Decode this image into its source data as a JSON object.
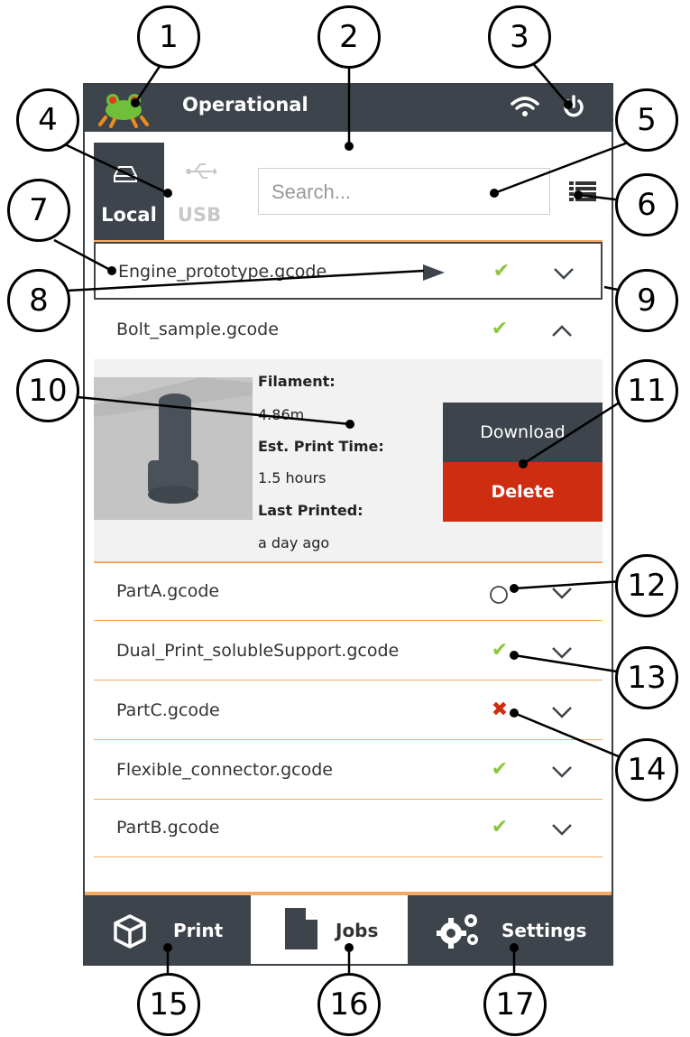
{
  "header": {
    "status_title": "Operational"
  },
  "source_tabs": [
    {
      "label": "Local"
    },
    {
      "label": "USB"
    }
  ],
  "search": {
    "placeholder": "Search..."
  },
  "files": [
    {
      "name": "Engine_prototype.gcode",
      "status": "check",
      "expanded": false,
      "selected": true
    },
    {
      "name": "Bolt_sample.gcode",
      "status": "check",
      "expanded": true
    },
    {
      "name": "PartA.gcode",
      "status": "none",
      "expanded": false
    },
    {
      "name": "Dual_Print_solubleSupport.gcode",
      "status": "check",
      "expanded": false
    },
    {
      "name": "PartC.gcode",
      "status": "error",
      "expanded": false
    },
    {
      "name": "Flexible_connector.gcode",
      "status": "check",
      "expanded": false
    },
    {
      "name": "PartB.gcode",
      "status": "check",
      "expanded": false
    }
  ],
  "details": {
    "filament_label": "Filament:",
    "filament_value": "4.86m",
    "time_label": "Est. Print Time:",
    "time_value": "1.5 hours",
    "last_label": "Last Printed:",
    "last_value": "a day ago",
    "download_label": "Download",
    "delete_label": "Delete"
  },
  "nav": [
    {
      "label": "Print"
    },
    {
      "label": "Jobs"
    },
    {
      "label": "Settings"
    }
  ],
  "callouts": [
    "1",
    "2",
    "3",
    "4",
    "5",
    "6",
    "7",
    "8",
    "9",
    "10",
    "11",
    "12",
    "13",
    "14",
    "15",
    "16",
    "17"
  ],
  "colors": {
    "bar": "#3e444b",
    "accent": "#f3a964",
    "ok": "#8cc63f",
    "danger": "#cf2d10"
  }
}
